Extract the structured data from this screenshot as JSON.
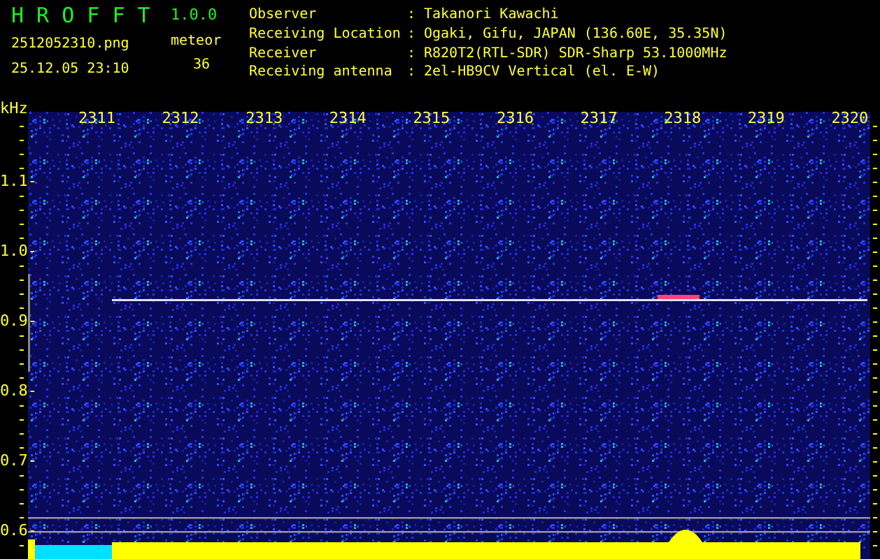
{
  "app": {
    "title": "H R O F F T",
    "version": "1.0.0"
  },
  "file": {
    "name": "2512052310.png",
    "datetime": "25.12.05 23:10"
  },
  "meteor": {
    "label": "meteor",
    "count": "36"
  },
  "info": [
    {
      "label": "Observer",
      "colon": ":",
      "value": "Takanori Kawachi"
    },
    {
      "label": "Receiving Location",
      "colon": ":",
      "value": "Ogaki, Gifu, JAPAN (136.60E, 35.35N)"
    },
    {
      "label": "Receiver",
      "colon": ":",
      "value": "R820T2(RTL-SDR) SDR-Sharp 53.1000MHz"
    },
    {
      "label": "Receiving antenna",
      "colon": ":",
      "value": "2el-HB9CV Vertical (el. E-W)"
    }
  ],
  "spectrogram": {
    "y_unit": "kHz",
    "y_labels": [
      "1.1-",
      "1.0-",
      "0.9-",
      "0.8-",
      "0.7-",
      "0.6-"
    ],
    "time_labels": [
      "2311",
      "2312",
      "2313",
      "2314",
      "2315",
      "2316",
      "2317",
      "2318",
      "2319",
      "2320"
    ]
  }
}
